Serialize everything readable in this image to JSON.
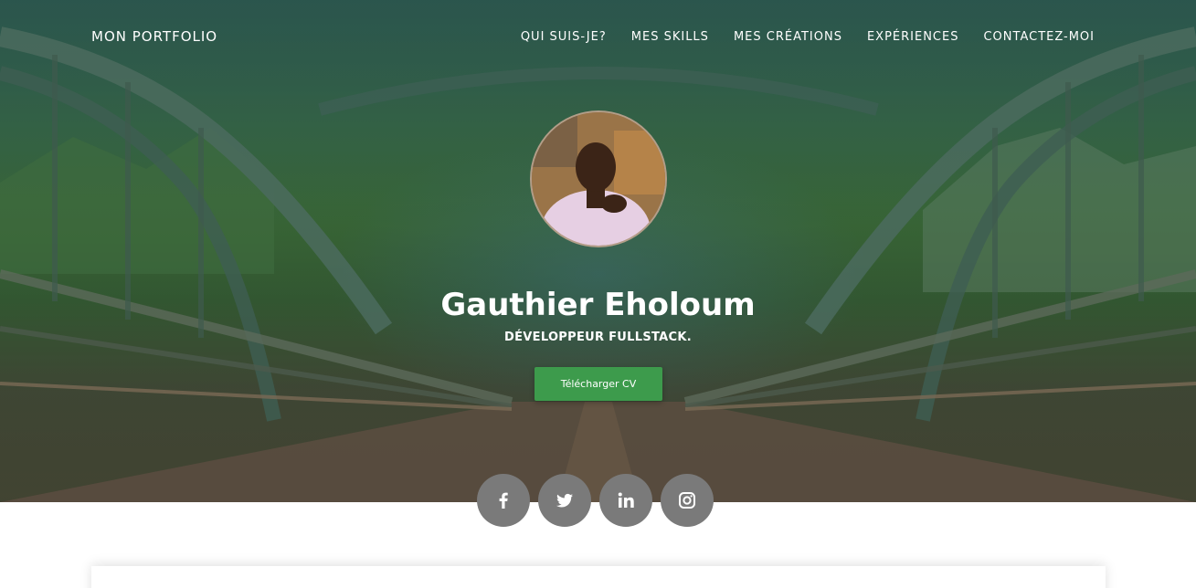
{
  "header": {
    "brand": "MON PORTFOLIO",
    "nav": [
      {
        "label": "QUI SUIS-JE?"
      },
      {
        "label": "MES SKILLS"
      },
      {
        "label": "MES CRÉATIONS"
      },
      {
        "label": "EXPÉRIENCES"
      },
      {
        "label": "CONTACTEZ-MOI"
      }
    ]
  },
  "hero": {
    "name": "Gauthier Eholoum",
    "role": "DÉVELOPPEUR FULLSTACK.",
    "cv_button": "Télécharger CV"
  },
  "socials": [
    {
      "icon": "facebook-icon"
    },
    {
      "icon": "twitter-icon"
    },
    {
      "icon": "linkedin-icon"
    },
    {
      "icon": "instagram-icon"
    }
  ],
  "colors": {
    "accent": "#3d9b4c",
    "social_bg": "#7a7a7a",
    "text_light": "#ffffff"
  }
}
